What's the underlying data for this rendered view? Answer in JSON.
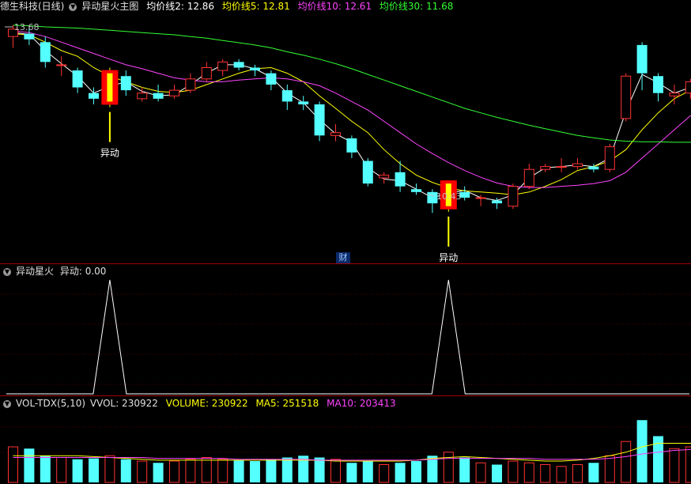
{
  "window": {
    "stock_title": "德生科技(日线)",
    "indicator_name": "异动星火主图"
  },
  "ma_legend": [
    {
      "label": "均价线2: 12.86",
      "color": "#ffffff"
    },
    {
      "label": "均价线5: 12.81",
      "color": "#ffff00"
    },
    {
      "label": "均价线10: 12.61",
      "color": "#ff44ff"
    },
    {
      "label": "均价线30: 11.68",
      "color": "#33ff33"
    }
  ],
  "main_chart": {
    "price_high_label": "13.68",
    "price_low_label": "10.43",
    "signal_label": "异动",
    "finance_tag": "财"
  },
  "signal_panel": {
    "name": "异动星火",
    "value_label": "异动: 0.00"
  },
  "volume_panel": {
    "name": "VOL-TDX(5,10)",
    "vvol_label": "VVOL: 230922",
    "volume_label": "VOLUME: 230922",
    "ma5_label": "MA5: 251518",
    "ma10_label": "MA10: 203413"
  },
  "colors": {
    "up": "#ff3232",
    "down": "#54ffff",
    "ma2": "#ffffff",
    "ma5": "#ffff00",
    "ma10": "#ff44ff",
    "ma30": "#33ff33",
    "separator": "#a00000"
  },
  "chart_data": {
    "type": "candlestick",
    "price_range": [
      10.0,
      14.0
    ],
    "candles": [
      {
        "o": 13.55,
        "c": 13.68,
        "h": 13.75,
        "l": 13.35
      },
      {
        "o": 13.6,
        "c": 13.5,
        "h": 13.7,
        "l": 13.4
      },
      {
        "o": 13.45,
        "c": 13.1,
        "h": 13.55,
        "l": 13.0
      },
      {
        "o": 13.05,
        "c": 13.05,
        "h": 13.2,
        "l": 12.85
      },
      {
        "o": 12.95,
        "c": 12.65,
        "h": 13.0,
        "l": 12.55
      },
      {
        "o": 12.55,
        "c": 12.45,
        "h": 12.65,
        "l": 12.35
      },
      {
        "o": 12.4,
        "c": 12.9,
        "h": 13.0,
        "l": 12.3,
        "signal": true
      },
      {
        "o": 12.85,
        "c": 12.6,
        "h": 12.95,
        "l": 12.5
      },
      {
        "o": 12.45,
        "c": 12.55,
        "h": 12.65,
        "l": 12.4
      },
      {
        "o": 12.55,
        "c": 12.45,
        "h": 12.7,
        "l": 12.4
      },
      {
        "o": 12.5,
        "c": 12.6,
        "h": 12.7,
        "l": 12.45
      },
      {
        "o": 12.6,
        "c": 12.8,
        "h": 12.9,
        "l": 12.55
      },
      {
        "o": 12.8,
        "c": 13.0,
        "h": 13.1,
        "l": 12.75
      },
      {
        "o": 12.95,
        "c": 13.1,
        "h": 13.15,
        "l": 12.85
      },
      {
        "o": 13.1,
        "c": 13.0,
        "h": 13.15,
        "l": 12.95
      },
      {
        "o": 13.0,
        "c": 12.95,
        "h": 13.05,
        "l": 12.85
      },
      {
        "o": 12.9,
        "c": 12.7,
        "h": 12.95,
        "l": 12.6
      },
      {
        "o": 12.6,
        "c": 12.4,
        "h": 12.7,
        "l": 12.25
      },
      {
        "o": 12.4,
        "c": 12.35,
        "h": 12.5,
        "l": 12.25
      },
      {
        "o": 12.35,
        "c": 11.8,
        "h": 12.4,
        "l": 11.7
      },
      {
        "o": 11.8,
        "c": 11.85,
        "h": 12.0,
        "l": 11.7
      },
      {
        "o": 11.75,
        "c": 11.5,
        "h": 11.8,
        "l": 11.4
      },
      {
        "o": 11.35,
        "c": 10.95,
        "h": 11.4,
        "l": 10.9
      },
      {
        "o": 11.05,
        "c": 11.1,
        "h": 11.15,
        "l": 10.95
      },
      {
        "o": 11.15,
        "c": 10.9,
        "h": 11.35,
        "l": 10.8
      },
      {
        "o": 10.85,
        "c": 10.8,
        "h": 10.95,
        "l": 10.75
      },
      {
        "o": 10.8,
        "c": 10.6,
        "h": 10.85,
        "l": 10.43
      },
      {
        "o": 10.55,
        "c": 10.95,
        "h": 11.0,
        "l": 10.45,
        "signal": true
      },
      {
        "o": 10.8,
        "c": 10.7,
        "h": 10.9,
        "l": 10.65
      },
      {
        "o": 10.7,
        "c": 10.7,
        "h": 10.75,
        "l": 10.55
      },
      {
        "o": 10.65,
        "c": 10.6,
        "h": 10.7,
        "l": 10.5
      },
      {
        "o": 10.55,
        "c": 10.9,
        "h": 10.95,
        "l": 10.5
      },
      {
        "o": 10.9,
        "c": 11.2,
        "h": 11.3,
        "l": 10.85
      },
      {
        "o": 11.2,
        "c": 11.25,
        "h": 11.3,
        "l": 11.15
      },
      {
        "o": 11.25,
        "c": 11.25,
        "h": 11.4,
        "l": 11.15
      },
      {
        "o": 11.25,
        "c": 11.3,
        "h": 11.4,
        "l": 11.2
      },
      {
        "o": 11.25,
        "c": 11.2,
        "h": 11.3,
        "l": 11.15
      },
      {
        "o": 11.2,
        "c": 11.6,
        "h": 11.65,
        "l": 11.15
      },
      {
        "o": 12.1,
        "c": 12.85,
        "h": 12.9,
        "l": 12.05
      },
      {
        "o": 13.4,
        "c": 12.9,
        "h": 13.45,
        "l": 12.6
      },
      {
        "o": 12.85,
        "c": 12.55,
        "h": 12.9,
        "l": 12.4
      },
      {
        "o": 12.5,
        "c": 12.55,
        "h": 12.7,
        "l": 12.35
      },
      {
        "o": 12.55,
        "c": 12.75,
        "h": 12.8,
        "l": 12.45
      },
      {
        "o": 12.7,
        "c": 12.6,
        "h": 12.8,
        "l": 12.55
      }
    ],
    "ma_series": [
      {
        "name": "均价线2",
        "values": [
          13.62,
          13.59,
          13.3,
          13.07,
          12.85,
          12.55,
          12.67,
          12.75,
          12.58,
          12.5,
          12.52,
          12.7,
          12.9,
          13.05,
          13.05,
          12.98,
          12.83,
          12.55,
          12.38,
          12.08,
          11.83,
          11.68,
          11.23,
          11.03,
          11.0,
          10.85,
          10.7,
          10.78,
          10.83,
          10.7,
          10.65,
          10.75,
          11.05,
          11.23,
          11.25,
          11.28,
          11.25,
          11.4,
          12.23,
          12.88,
          12.73,
          12.55,
          12.65,
          12.68
        ]
      },
      {
        "name": "均价线5",
        "values": [
          13.6,
          13.58,
          13.45,
          13.3,
          13.2,
          13.0,
          12.85,
          12.75,
          12.65,
          12.58,
          12.56,
          12.6,
          12.7,
          12.8,
          12.9,
          12.98,
          13.0,
          12.9,
          12.75,
          12.5,
          12.28,
          12.05,
          11.85,
          11.55,
          11.3,
          11.1,
          10.97,
          10.87,
          10.82,
          10.8,
          10.78,
          10.75,
          10.8,
          10.9,
          11.02,
          11.18,
          11.25,
          11.35,
          11.55,
          11.9,
          12.2,
          12.45,
          12.6,
          12.7
        ]
      },
      {
        "name": "均价线10",
        "values": [
          13.65,
          13.62,
          13.55,
          13.45,
          13.35,
          13.25,
          13.15,
          13.05,
          12.98,
          12.9,
          12.82,
          12.78,
          12.75,
          12.75,
          12.78,
          12.8,
          12.82,
          12.8,
          12.75,
          12.68,
          12.55,
          12.4,
          12.25,
          12.05,
          11.85,
          11.65,
          11.48,
          11.32,
          11.18,
          11.06,
          10.96,
          10.9,
          10.88,
          10.88,
          10.9,
          10.92,
          10.95,
          11.0,
          11.15,
          11.4,
          11.65,
          11.9,
          12.15,
          12.3
        ]
      },
      {
        "name": "均价线30",
        "values": [
          13.75,
          13.74,
          13.72,
          13.71,
          13.7,
          13.68,
          13.66,
          13.64,
          13.62,
          13.6,
          13.58,
          13.55,
          13.52,
          13.48,
          13.44,
          13.4,
          13.35,
          13.28,
          13.22,
          13.15,
          13.07,
          12.98,
          12.88,
          12.78,
          12.68,
          12.58,
          12.48,
          12.38,
          12.28,
          12.2,
          12.12,
          12.05,
          11.98,
          11.92,
          11.86,
          11.8,
          11.76,
          11.72,
          11.7,
          11.69,
          11.69,
          11.68,
          11.68,
          11.68
        ]
      }
    ],
    "signal_values_note": "",
    "signal_index": [
      6,
      27
    ],
    "volumes": [
      40,
      38,
      30,
      28,
      26,
      27,
      30,
      26,
      24,
      22,
      24,
      26,
      28,
      26,
      25,
      24,
      26,
      28,
      30,
      28,
      26,
      22,
      24,
      20,
      22,
      24,
      30,
      34,
      28,
      22,
      20,
      24,
      22,
      20,
      18,
      20,
      22,
      30,
      46,
      70,
      52,
      38,
      40,
      36
    ],
    "vol_ma5": [
      30,
      30,
      30,
      30,
      30,
      29,
      28,
      27,
      26,
      25,
      25,
      25,
      25,
      25,
      25,
      25,
      25,
      25,
      25,
      25,
      24,
      24,
      24,
      24,
      24,
      25,
      27,
      28,
      29,
      28,
      27,
      26,
      25,
      24,
      24,
      25,
      27,
      30,
      34,
      40,
      44,
      44,
      44,
      44
    ],
    "vol_ma10": [
      28,
      28,
      28,
      28,
      28,
      28,
      28,
      28,
      28,
      27,
      27,
      27,
      27,
      27,
      26,
      26,
      26,
      26,
      26,
      25,
      25,
      25,
      25,
      25,
      25,
      25,
      26,
      27,
      27,
      27,
      27,
      27,
      27,
      26,
      26,
      26,
      26,
      27,
      29,
      32,
      34,
      36,
      37,
      38
    ]
  }
}
